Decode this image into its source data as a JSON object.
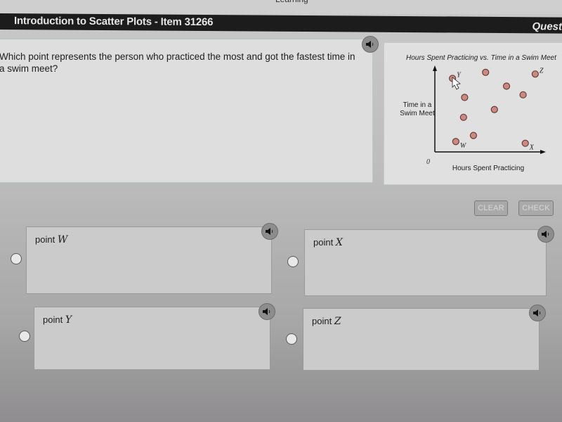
{
  "window": {
    "top_fragment": "Learning",
    "title": "Introduction to Scatter Plots - Item 31266",
    "right_label": "Quest"
  },
  "question": {
    "text": "Which point represents the person who practiced the most and got the fastest time in a swim meet?",
    "audio_icon": "speaker-icon"
  },
  "buttons": {
    "clear": "CLEAR",
    "check": "CHECK"
  },
  "choices": [
    {
      "prefix": "point",
      "var": "W"
    },
    {
      "prefix": "point",
      "var": "X"
    },
    {
      "prefix": "point",
      "var": "Y"
    },
    {
      "prefix": "point",
      "var": "Z"
    }
  ],
  "colors": {
    "title_bar": "#1c1c1c",
    "point_fill": "#c98a82",
    "point_stroke": "#6b3b36"
  },
  "chart_data": {
    "type": "scatter",
    "title": "Hours Spent Practicing vs. Time in a Swim Meet",
    "xlabel": "Hours Spent Practicing",
    "ylabel": "Time in a Swim Meet",
    "origin_label": "0",
    "xlim": [
      0,
      10
    ],
    "ylim": [
      0,
      10
    ],
    "grid": false,
    "points": [
      {
        "x": 1.6,
        "y": 8.5,
        "label": "Y"
      },
      {
        "x": 4.6,
        "y": 9.2,
        "label": ""
      },
      {
        "x": 9.1,
        "y": 9.0,
        "label": "Z"
      },
      {
        "x": 6.5,
        "y": 7.6,
        "label": ""
      },
      {
        "x": 8.0,
        "y": 6.6,
        "label": ""
      },
      {
        "x": 2.7,
        "y": 6.3,
        "label": ""
      },
      {
        "x": 5.4,
        "y": 4.9,
        "label": ""
      },
      {
        "x": 2.6,
        "y": 4.0,
        "label": ""
      },
      {
        "x": 3.5,
        "y": 1.9,
        "label": ""
      },
      {
        "x": 1.9,
        "y": 1.2,
        "label": "W"
      },
      {
        "x": 8.2,
        "y": 1.0,
        "label": "X"
      }
    ]
  }
}
